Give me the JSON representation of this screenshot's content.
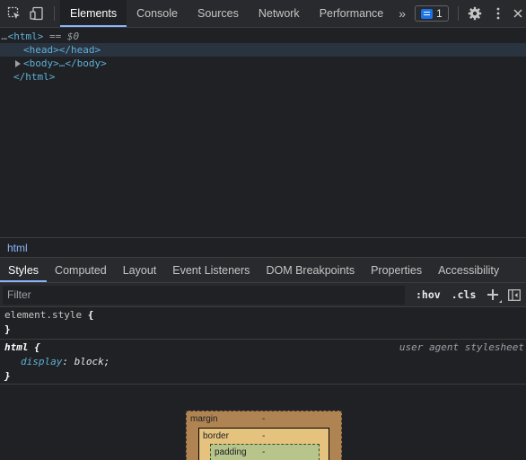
{
  "toolbar": {
    "tabs": [
      "Elements",
      "Console",
      "Sources",
      "Network",
      "Performance"
    ],
    "more": "»",
    "issues_count": "1"
  },
  "dom": {
    "html_open_prefix": "…",
    "html_open": "<html>",
    "selected_marker": " == $0",
    "head": "<head></head>",
    "body": "<body>…</body>",
    "html_close": "</html>"
  },
  "breadcrumb": {
    "items": [
      "html"
    ]
  },
  "subtabs": [
    "Styles",
    "Computed",
    "Layout",
    "Event Listeners",
    "DOM Breakpoints",
    "Properties",
    "Accessibility"
  ],
  "filter": {
    "placeholder": "Filter",
    "hov": ":hov",
    "cls": ".cls"
  },
  "styles": {
    "element_style": {
      "selector": "element.style",
      "open": "{",
      "close": "}"
    },
    "html_rule": {
      "selector": "html",
      "open": "{",
      "source": "user agent stylesheet",
      "property": "display",
      "colon": ": ",
      "value": "block;",
      "close": "}"
    }
  },
  "box_model": {
    "margin_label": "margin",
    "margin_value": "-",
    "border_label": "border",
    "border_value": "-",
    "padding_label": "padding",
    "padding_value": "-"
  },
  "colors": {
    "accent": "#8ab4f8",
    "tag": "#5db0d7",
    "background": "#202124",
    "margin": "#b08353",
    "border": "#e6c27f",
    "padding": "#b7c48a"
  }
}
